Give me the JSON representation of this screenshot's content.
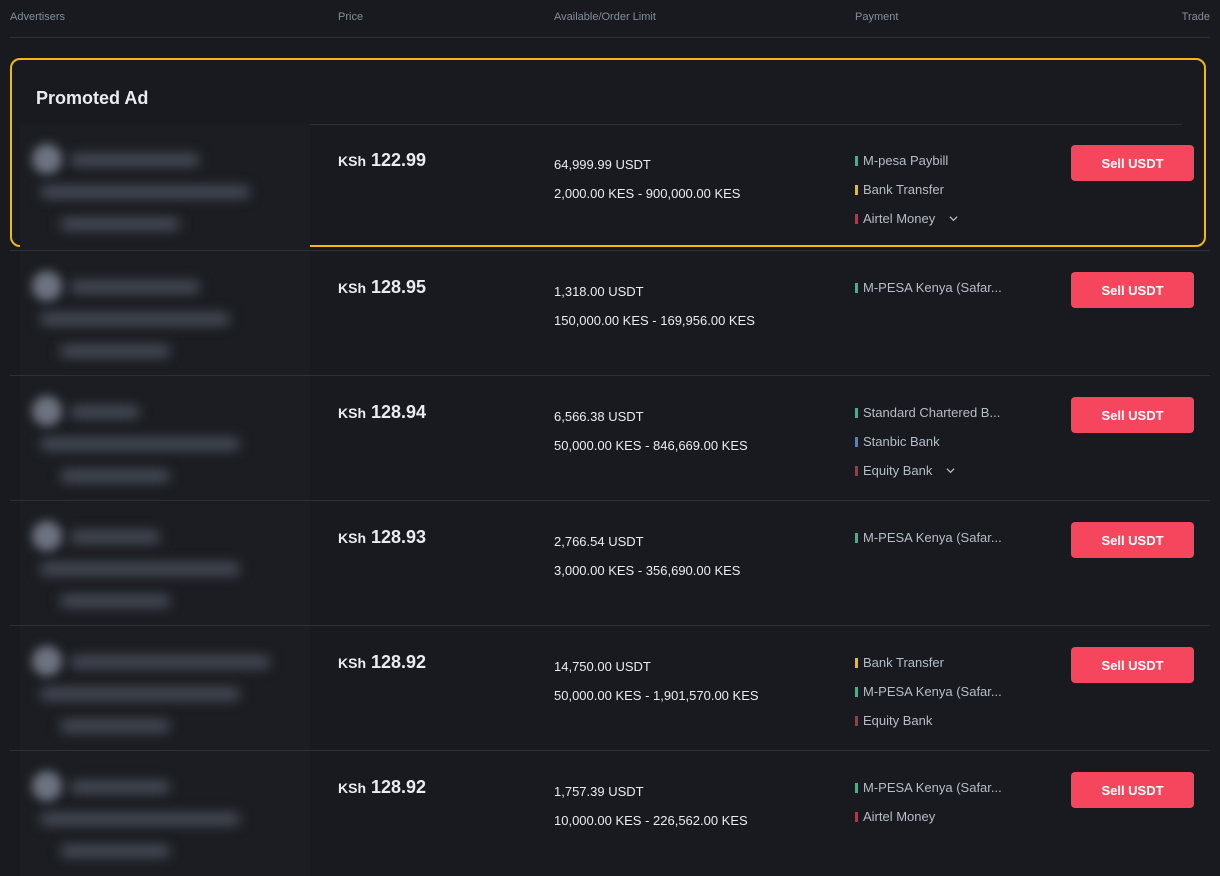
{
  "header": {
    "advertisers": "Advertisers",
    "price": "Price",
    "available": "Available/Order Limit",
    "payment": "Payment",
    "trade": "Trade"
  },
  "promoted": {
    "title": "Promoted Ad"
  },
  "colors": {
    "accent_promo": "#f0b90b",
    "sell": "#f6465d",
    "green": "#2ebd85",
    "yellow": "#f0b90b",
    "red": "#e0223b",
    "blue": "#4f7fd6",
    "darkred": "#a23a3a"
  },
  "currency": "KSh",
  "ads": [
    {
      "price": "122.99",
      "available": "64,999.99 USDT",
      "limit": "2,000.00 KES - 900,000.00 KES",
      "payments": [
        {
          "name": "M-pesa Paybill",
          "color": "#2ebd85"
        },
        {
          "name": "Bank Transfer",
          "color": "#f0b90b"
        },
        {
          "name": "Airtel Money",
          "color": "#e0223b",
          "more": true
        }
      ],
      "button": "Sell USDT"
    },
    {
      "price": "128.95",
      "available": "1,318.00 USDT",
      "limit": "150,000.00 KES - 169,956.00 KES",
      "payments": [
        {
          "name": "M-PESA Kenya (Safar...",
          "color": "#2ebd85"
        }
      ],
      "button": "Sell USDT"
    },
    {
      "price": "128.94",
      "available": "6,566.38 USDT",
      "limit": "50,000.00 KES - 846,669.00 KES",
      "payments": [
        {
          "name": "Standard Chartered B...",
          "color": "#2ebd85"
        },
        {
          "name": "Stanbic Bank",
          "color": "#4f7fd6"
        },
        {
          "name": "Equity Bank",
          "color": "#a23a3a",
          "more": true
        }
      ],
      "button": "Sell USDT"
    },
    {
      "price": "128.93",
      "available": "2,766.54 USDT",
      "limit": "3,000.00 KES - 356,690.00 KES",
      "payments": [
        {
          "name": "M-PESA Kenya (Safar...",
          "color": "#2ebd85"
        }
      ],
      "button": "Sell USDT"
    },
    {
      "price": "128.92",
      "available": "14,750.00 USDT",
      "limit": "50,000.00 KES - 1,901,570.00 KES",
      "payments": [
        {
          "name": "Bank Transfer",
          "color": "#f0b90b"
        },
        {
          "name": "M-PESA Kenya (Safar...",
          "color": "#2ebd85"
        },
        {
          "name": "Equity Bank",
          "color": "#a23a3a"
        }
      ],
      "button": "Sell USDT"
    },
    {
      "price": "128.92",
      "available": "1,757.39 USDT",
      "limit": "10,000.00 KES - 226,562.00 KES",
      "payments": [
        {
          "name": "M-PESA Kenya (Safar...",
          "color": "#2ebd85"
        },
        {
          "name": "Airtel Money",
          "color": "#e0223b"
        }
      ],
      "button": "Sell USDT"
    }
  ]
}
